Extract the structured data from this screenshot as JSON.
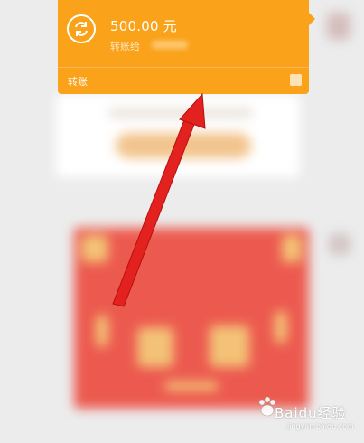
{
  "transfer": {
    "amount": "500.00 元",
    "to_label": "转账给",
    "footer_label": "转账"
  },
  "watermark": {
    "text": "Baidu经验",
    "sub": "jingyan.baidu.com"
  },
  "colors": {
    "bubble": "#f9a21a",
    "arrow": "#e3211e",
    "red_envelope": "#ec5a4f",
    "receive_button": "#f2c48d"
  },
  "icons": {
    "transfer": "transfer-exchange-icon",
    "footer": "tencent-pay-icon",
    "watermark": "baidu-paw-icon"
  }
}
